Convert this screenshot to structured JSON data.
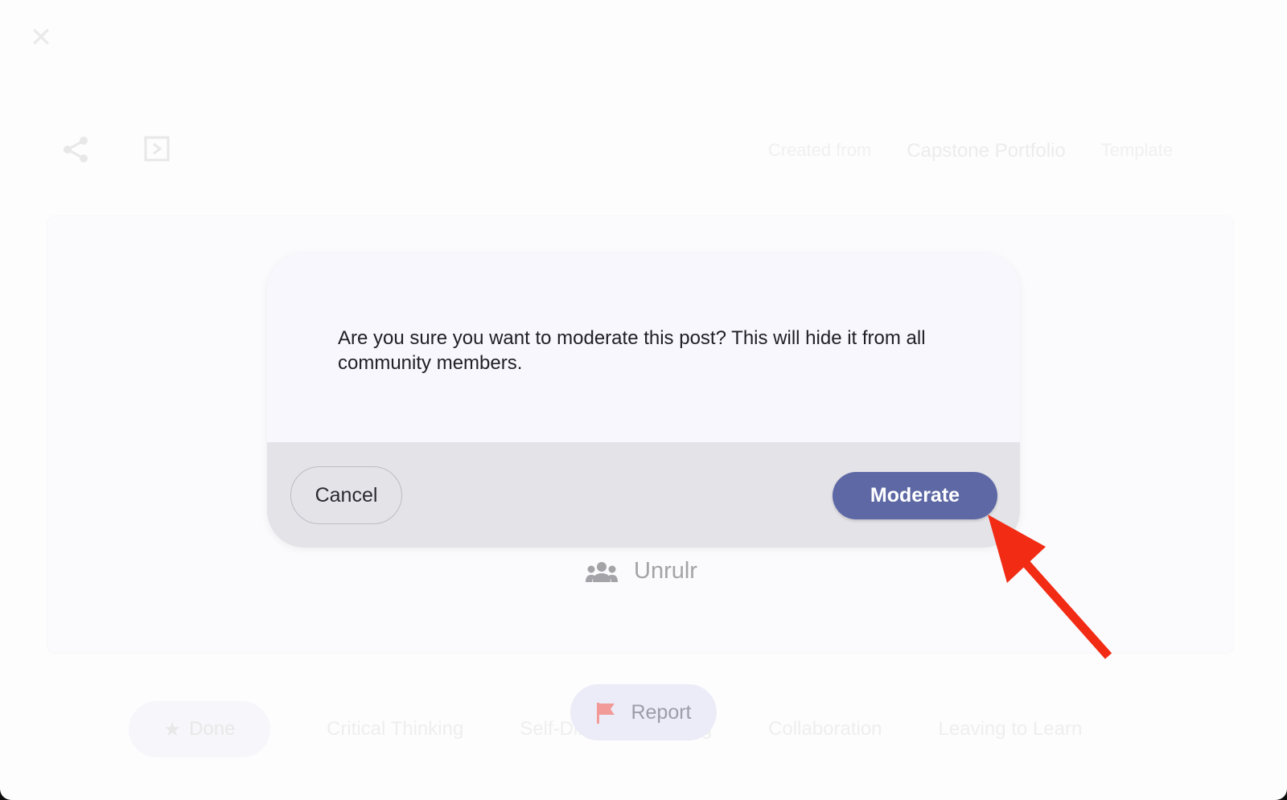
{
  "background": {
    "breadcrumb": [
      "Created from",
      "Capstone Portfolio",
      "Template"
    ],
    "tags": [
      "Done",
      "Critical Thinking",
      "Self-Directed Learning",
      "Collaboration",
      "Leaving to Learn"
    ]
  },
  "group": {
    "name": "Unrulr",
    "icon": "group-icon"
  },
  "report": {
    "label": "Report",
    "icon": "flag-icon"
  },
  "modal": {
    "message": "Are you sure you want to moderate this post?  This will hide it from all community members.",
    "cancel_label": "Cancel",
    "moderate_label": "Moderate"
  },
  "colors": {
    "moderate_button": "#5d68a5",
    "annotation_arrow": "#f22b14",
    "modal_body": "#f8f7fd",
    "modal_footer": "#e3e3e8"
  }
}
